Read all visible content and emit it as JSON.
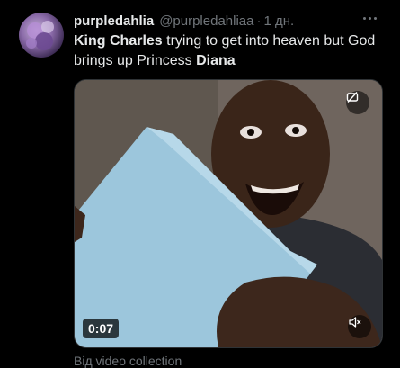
{
  "tweet": {
    "display_name": "purpledahlia",
    "handle": "@purpledahliaa",
    "separator": "·",
    "time": "1 дн.",
    "text_parts": {
      "bold1": "King Charles",
      "mid": " trying to get into heaven but God brings up Princess ",
      "bold2": "Diana"
    },
    "media": {
      "duration": "0:07"
    },
    "source_label": "Від video collection"
  },
  "icons": {
    "more": "more-horizontal-icon",
    "mute": "speaker-muted-icon",
    "gif": "autoplay-icon"
  }
}
